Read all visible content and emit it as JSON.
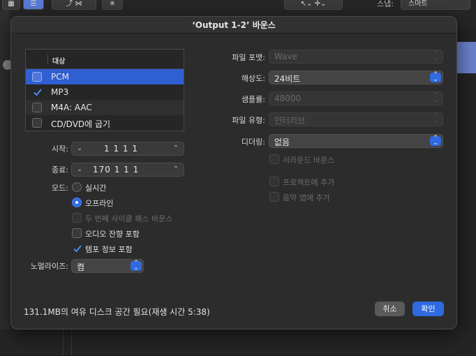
{
  "background": {
    "toolbar_snap_label": "스냅:",
    "toolbar_snap_value": "스마트"
  },
  "dialog": {
    "title": "‘Output 1-2’ 바운스",
    "destination": {
      "header": "대상",
      "items": [
        {
          "label": "PCM",
          "checked": false,
          "selected": true
        },
        {
          "label": "MP3",
          "checked": true,
          "selected": false
        },
        {
          "label": "M4A: AAC",
          "checked": false,
          "selected": false
        },
        {
          "label": "CD/DVD에 굽기",
          "checked": false,
          "selected": false
        }
      ]
    },
    "start": {
      "label": "시작:",
      "value": "1  1  1      1"
    },
    "end": {
      "label": "종료:",
      "value": "170  1  1      1"
    },
    "mode": {
      "label": "모드:",
      "options": [
        {
          "label": "실시간",
          "on": false
        },
        {
          "label": "오프라인",
          "on": true
        }
      ]
    },
    "checks": [
      {
        "label": "두 번째 사이클 패스 바운스",
        "checked": false,
        "enabled": false
      },
      {
        "label": "오디오 잔향 포함",
        "checked": false,
        "enabled": true
      },
      {
        "label": "템포 정보 포함",
        "checked": true,
        "enabled": true
      }
    ],
    "normalize": {
      "label": "노멀라이즈:",
      "value": "켬"
    },
    "file_format": {
      "label": "파일 포맷:",
      "value": "Wave"
    },
    "resolution": {
      "label": "해상도:",
      "value": "24비트"
    },
    "sample_rate": {
      "label": "샘플률:",
      "value": "48000"
    },
    "file_type": {
      "label": "파일 유형:",
      "value": "인터리브"
    },
    "dither": {
      "label": "디더링:",
      "value": "없음"
    },
    "right_checks": [
      {
        "label": "서라운드 바운스",
        "enabled": false
      },
      {
        "label": "프로젝트에 추가",
        "enabled": false
      },
      {
        "label": "음악 앱에 추가",
        "enabled": false
      }
    ],
    "disk_info": "131.1MB의 여유 디스크 공간 필요(재생 시간 5:38)",
    "cancel_label": "취소",
    "ok_label": "확인"
  },
  "colors": {
    "accent": "#2f6ae0",
    "selection": "#2f5fd1"
  }
}
